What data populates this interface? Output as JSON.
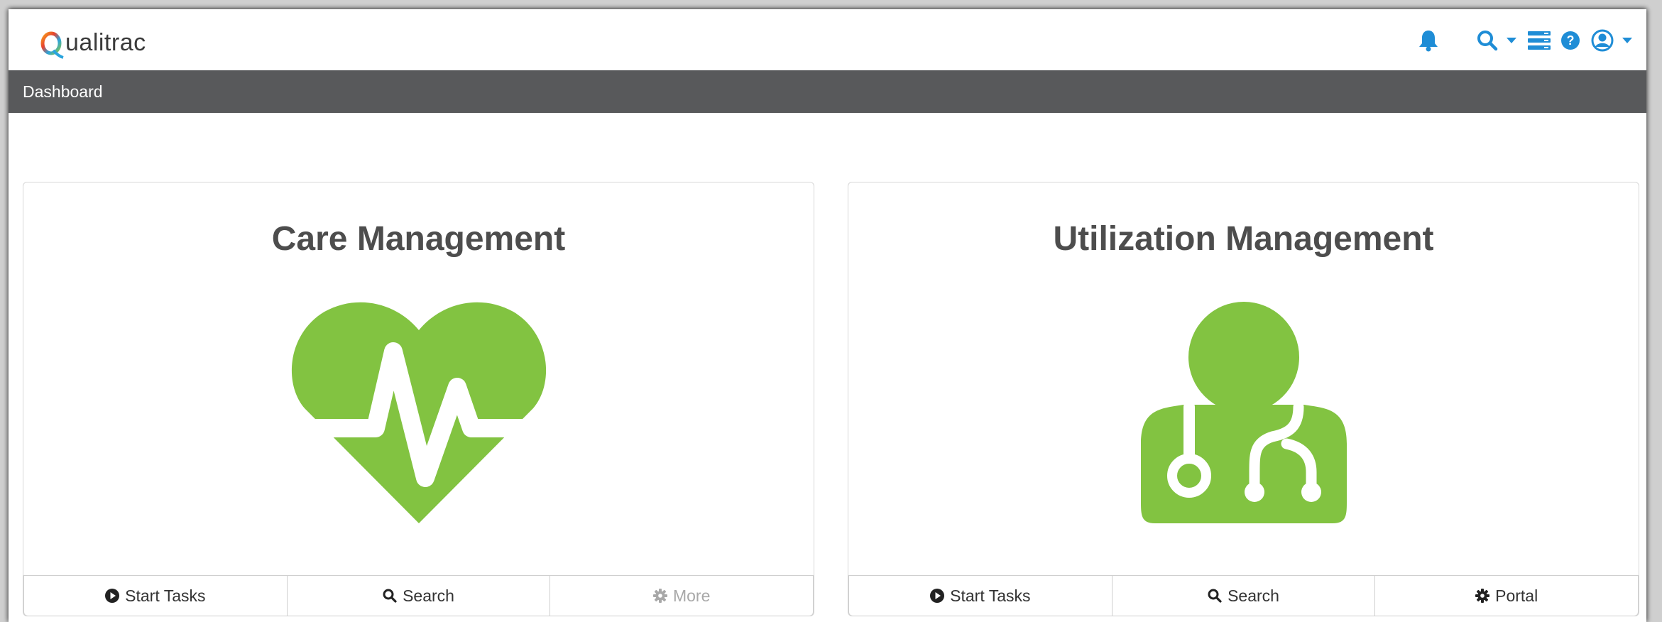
{
  "brand": {
    "name": "ualitrac",
    "logo_letter": "Q"
  },
  "nav": {
    "icons": [
      "bell-icon",
      "search-icon",
      "list-icon",
      "help-icon",
      "user-icon"
    ],
    "accent": "#1f8dd6"
  },
  "breadcrumb": {
    "label": "Dashboard"
  },
  "panels": [
    {
      "title": "Care Management",
      "icon": "heart-pulse-icon",
      "icon_color": "#82c341",
      "buttons": [
        {
          "label": "Start Tasks",
          "icon": "play-circle-icon"
        },
        {
          "label": "Search",
          "icon": "search-icon"
        },
        {
          "label": "More",
          "icon": "gear-icon",
          "disabled": true
        }
      ]
    },
    {
      "title": "Utilization Management",
      "icon": "doctor-icon",
      "icon_color": "#82c341",
      "buttons": [
        {
          "label": "Start Tasks",
          "icon": "play-circle-icon"
        },
        {
          "label": "Search",
          "icon": "search-icon"
        },
        {
          "label": "Portal",
          "icon": "gear-icon"
        }
      ]
    }
  ]
}
